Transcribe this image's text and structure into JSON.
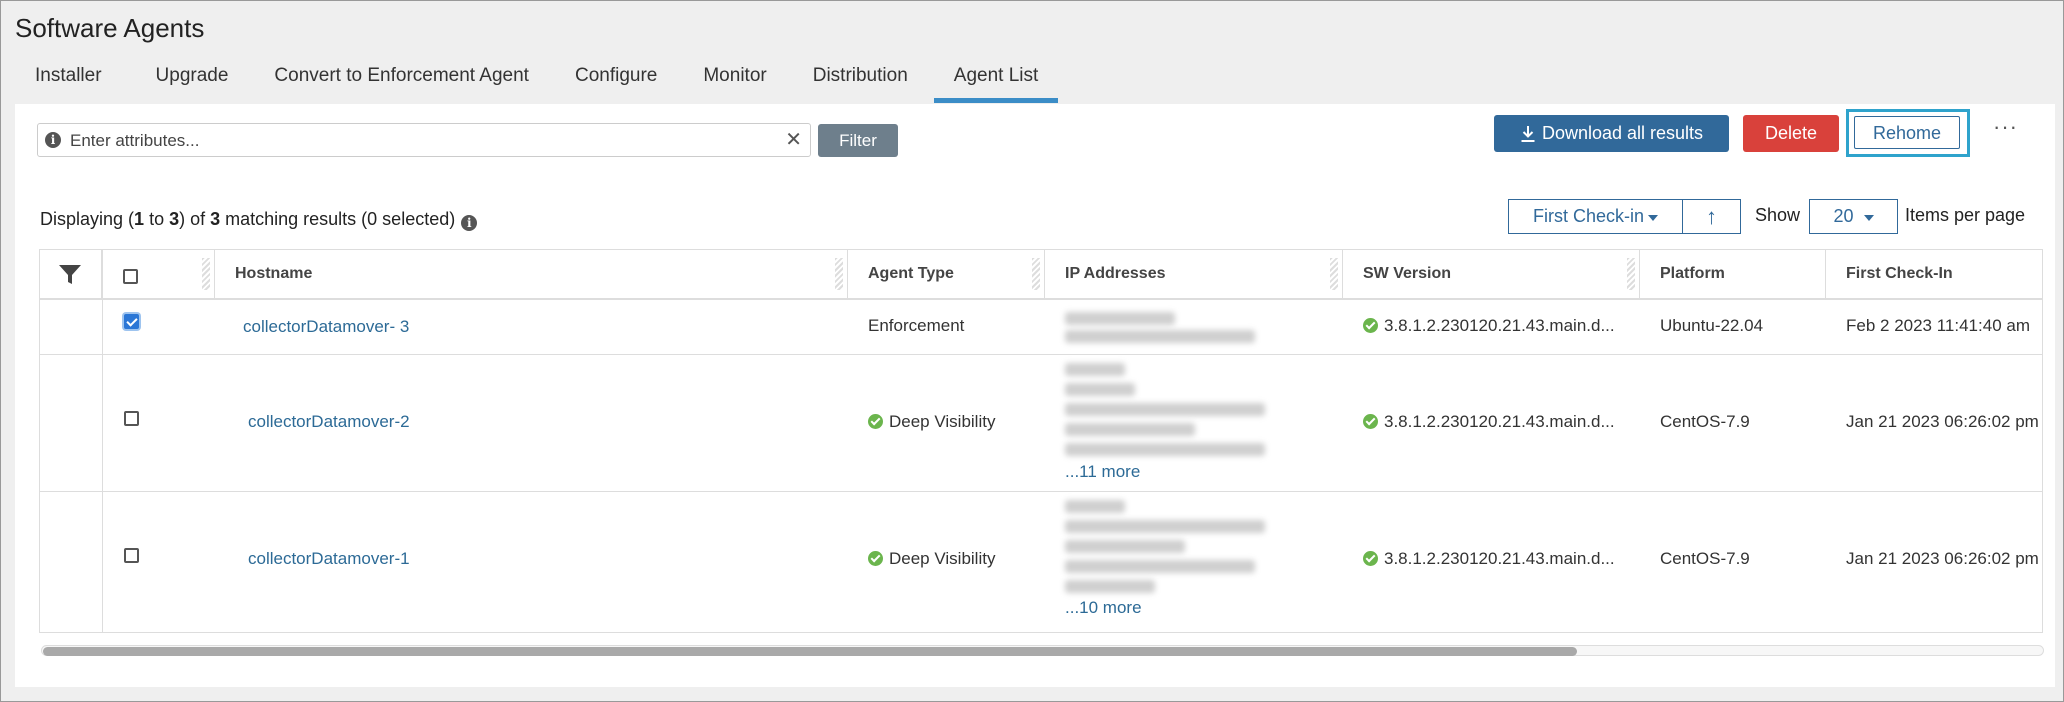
{
  "page": {
    "title": "Software Agents"
  },
  "tabs": [
    {
      "label": "Installer"
    },
    {
      "label": "Upgrade"
    },
    {
      "label": "Convert to Enforcement Agent"
    },
    {
      "label": "Configure"
    },
    {
      "label": "Monitor"
    },
    {
      "label": "Distribution"
    },
    {
      "label": "Agent List",
      "active": true
    }
  ],
  "search": {
    "placeholder": "Enter attributes...",
    "value": ""
  },
  "toolbar": {
    "filter_label": "Filter",
    "download_label": "Download all results",
    "delete_label": "Delete",
    "rehome_label": "Rehome",
    "more_label": "···"
  },
  "results": {
    "prefix": "Displaying (",
    "from": "1",
    "to_word": " to ",
    "to": "3",
    "mid": ") of ",
    "total": "3",
    "suffix": " matching results (0 selected)"
  },
  "sorting": {
    "field": "First Check-in",
    "direction_icon": "↑"
  },
  "paging": {
    "show_label": "Show",
    "per_page": "20",
    "per_page_label": "Items per page"
  },
  "columns": [
    "Hostname",
    "Agent Type",
    "IP Addresses",
    "SW Version",
    "Platform",
    "First Check-In"
  ],
  "rows": [
    {
      "selected": true,
      "hostname": "collectorDatamover- 3",
      "agent_type": "Enforcement",
      "agent_type_ok": false,
      "ip_more": "",
      "sw_version": "3.8.1.2.230120.21.43.main.d...",
      "platform": "Ubuntu-22.04",
      "first_checkin": "Feb 2 2023 11:41:40 am"
    },
    {
      "selected": false,
      "hostname": "collectorDatamover-2",
      "agent_type": "Deep Visibility",
      "agent_type_ok": true,
      "ip_more": "...11 more",
      "sw_version": "3.8.1.2.230120.21.43.main.d...",
      "platform": "CentOS-7.9",
      "first_checkin": "Jan 21 2023 06:26:02 pm"
    },
    {
      "selected": false,
      "hostname": "collectorDatamover-1",
      "agent_type": "Deep Visibility",
      "agent_type_ok": true,
      "ip_more": "...10 more",
      "sw_version": "3.8.1.2.230120.21.43.main.d...",
      "platform": "CentOS-7.9",
      "first_checkin": "Jan 21 2023 06:26:02 pm"
    }
  ],
  "colors": {
    "accent": "#31699a",
    "delete": "#d9413b",
    "highlight": "#2fa3cc",
    "ok": "#6bb54d"
  }
}
